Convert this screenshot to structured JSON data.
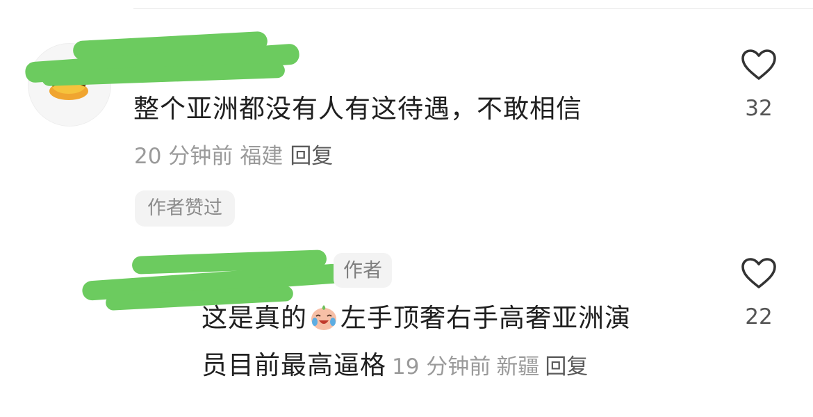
{
  "comments": [
    {
      "text": "整个亚洲都没有人有这待遇，不敢相信",
      "time": "20 分钟前",
      "location": "福建",
      "reply_label": "回复",
      "badge": "作者赞过",
      "like_count": "32"
    },
    {
      "author_badge": "作者",
      "text_line1_a": "这是真的",
      "emoji": "crying-laughing-peach-emoji",
      "text_line1_b": "左手顶奢右手高奢亚洲演",
      "text_line2": "员目前最高逼格",
      "time": "19 分钟前",
      "location": "新疆",
      "reply_label": "回复",
      "like_count": "22"
    }
  ],
  "icons": {
    "like": "heart-outline-icon"
  },
  "colors": {
    "redaction": "#6ccb5f",
    "meta": "#9a9a9a",
    "text": "#1f1f1f"
  }
}
